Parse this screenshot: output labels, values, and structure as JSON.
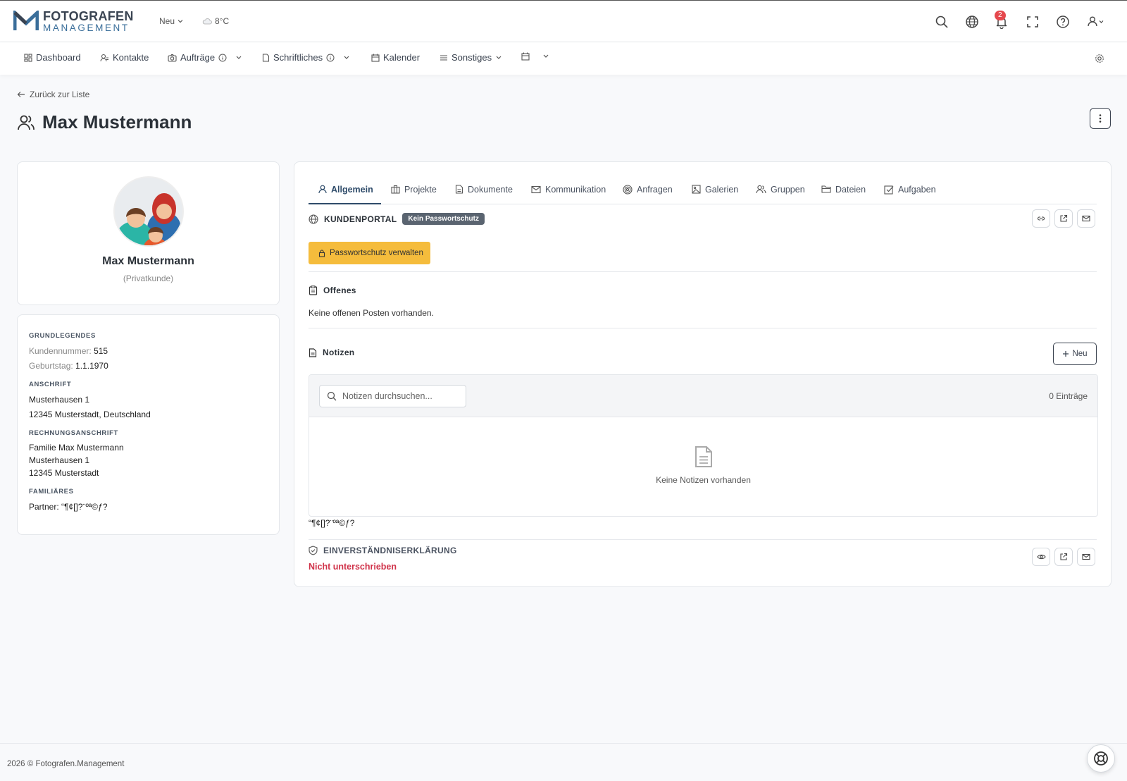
{
  "header": {
    "logo_line1": "FOTOGRAFEN",
    "logo_line2": "MANAGEMENT",
    "new_dropdown": "Neu",
    "weather": "8°C",
    "notification_count": "2",
    "icons": [
      "search-icon",
      "globe-icon",
      "bell-icon",
      "fullscreen-icon",
      "help-icon",
      "user-icon"
    ]
  },
  "nav": {
    "items": [
      {
        "label": "Dashboard",
        "icon": "dashboard-icon"
      },
      {
        "label": "Kontakte",
        "icon": "contacts-icon"
      },
      {
        "label": "Aufträge",
        "icon": "camera-icon"
      },
      {
        "label": "Schriftliches",
        "icon": "document-icon"
      },
      {
        "label": "Kalender",
        "icon": "calendar-icon"
      },
      {
        "label": "Sonstiges",
        "icon": "menu-icon"
      },
      {
        "label": "",
        "icon": "calendar-check-icon"
      }
    ]
  },
  "page": {
    "back_label": "Zurück zur Liste",
    "title": "Max Mustermann"
  },
  "profile": {
    "name": "Max Mustermann",
    "type": "(Privatkunde)"
  },
  "info": {
    "basic_heading": "GRUNDLEGENDES",
    "customer_number_label": "Kundennummer:",
    "customer_number": "515",
    "birthday_label": "Geburtstag:",
    "birthday": "1.1.1970",
    "address_heading": "ANSCHRIFT",
    "address_line1": "Musterhausen 1",
    "address_line2": "12345 Musterstadt, Deutschland",
    "billing_heading": "RECHNUNGSANSCHRIFT",
    "billing_line1": "Familie Max Mustermann",
    "billing_line2": "Musterhausen 1",
    "billing_line3": "12345 Musterstadt",
    "family_heading": "FAMILIÄRES",
    "partner": "Partner: “¶¢[]?¨ºª©ƒ?"
  },
  "tabs": [
    {
      "label": "Allgemein",
      "icon": "user-icon"
    },
    {
      "label": "Projekte",
      "icon": "briefcase-icon"
    },
    {
      "label": "Dokumente",
      "icon": "document-icon"
    },
    {
      "label": "Kommunikation",
      "icon": "mail-icon"
    },
    {
      "label": "Anfragen",
      "icon": "target-icon"
    },
    {
      "label": "Galerien",
      "icon": "image-icon"
    },
    {
      "label": "Gruppen",
      "icon": "group-icon"
    },
    {
      "label": "Dateien",
      "icon": "folder-icon"
    },
    {
      "label": "Aufgaben",
      "icon": "checkbox-icon"
    }
  ],
  "portal": {
    "heading": "KUNDENPORTAL",
    "badge": "Kein Passwortschutz",
    "manage_button": "Passwortschutz verwalten"
  },
  "open_items": {
    "heading": "Offenes",
    "empty_text": "Keine offenen Posten vorhanden."
  },
  "notes": {
    "heading": "Notizen",
    "new_button": "Neu",
    "search_placeholder": "Notizen durchsuchen...",
    "count": "0 Einträge",
    "empty_text": "Keine Notizen vorhanden"
  },
  "garbled_text": "“¶¢[]?¨ºª©ƒ?",
  "consent": {
    "heading": "EINVERSTÄNDNISERKLÄRUNG",
    "status": "Nicht unterschrieben"
  },
  "footer": {
    "text": "2026 © Fotografen.Management"
  },
  "colors": {
    "accent": "#2f4c6a",
    "warning": "#f5bc3c",
    "danger": "#d0334a",
    "badge": "#e5484d"
  }
}
